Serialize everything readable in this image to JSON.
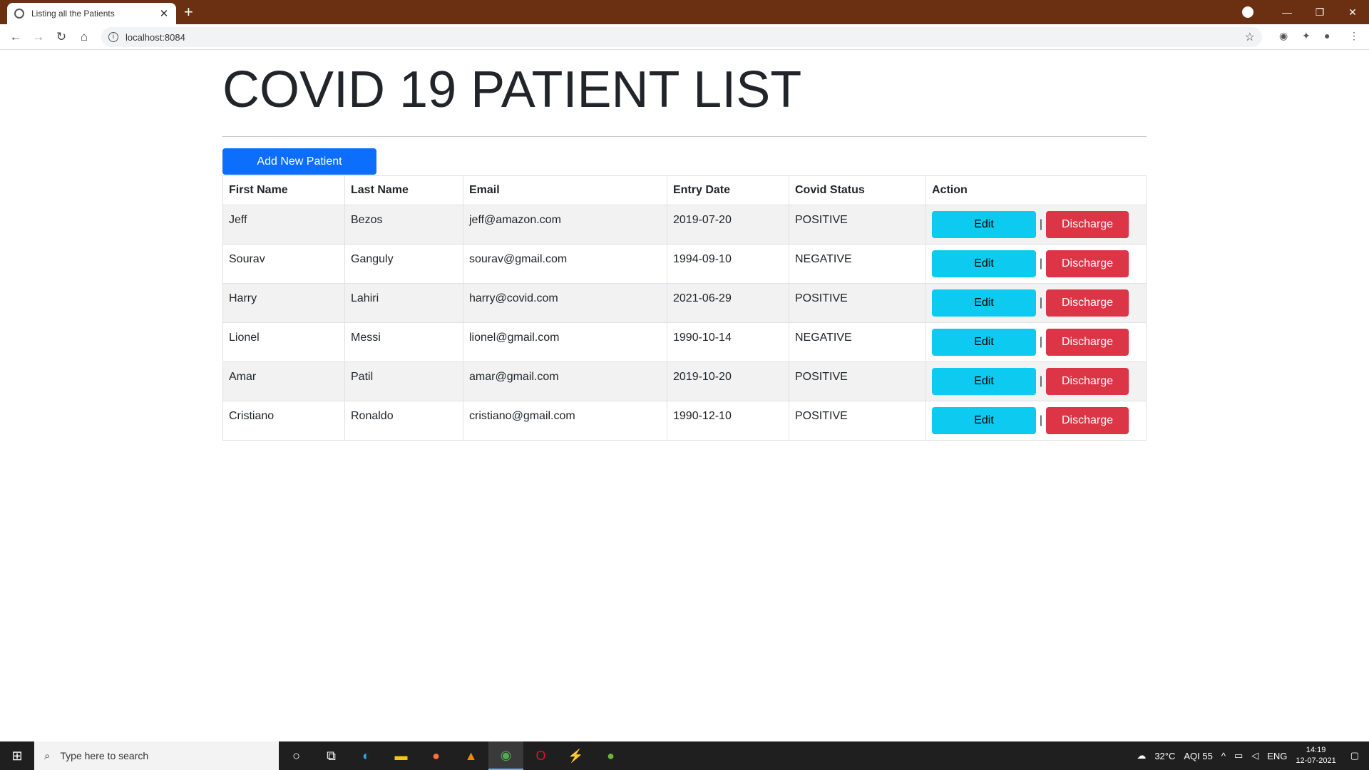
{
  "browser": {
    "tab_title": "Listing all the Patients",
    "url": "localhost:8084"
  },
  "page": {
    "heading": "COVID 19 PATIENT LIST",
    "add_button": "Add New Patient",
    "columns": [
      "First Name",
      "Last Name",
      "Email",
      "Entry Date",
      "Covid Status",
      "Action"
    ],
    "rows": [
      {
        "first": "Jeff",
        "last": "Bezos",
        "email": "jeff@amazon.com",
        "date": "2019-07-20",
        "status": "POSITIVE"
      },
      {
        "first": "Sourav",
        "last": "Ganguly",
        "email": "sourav@gmail.com",
        "date": "1994-09-10",
        "status": "NEGATIVE"
      },
      {
        "first": "Harry",
        "last": "Lahiri",
        "email": "harry@covid.com",
        "date": "2021-06-29",
        "status": "POSITIVE"
      },
      {
        "first": "Lionel",
        "last": "Messi",
        "email": "lionel@gmail.com",
        "date": "1990-10-14",
        "status": "NEGATIVE"
      },
      {
        "first": "Amar",
        "last": "Patil",
        "email": "amar@gmail.com",
        "date": "2019-10-20",
        "status": "POSITIVE"
      },
      {
        "first": "Cristiano",
        "last": "Ronaldo",
        "email": "cristiano@gmail.com",
        "date": "1990-12-10",
        "status": "POSITIVE"
      }
    ],
    "edit_label": "Edit",
    "separator": "|",
    "discharge_label": "Discharge"
  },
  "taskbar": {
    "search_placeholder": "Type here to search",
    "weather": "32°C",
    "aqi": "AQI 55",
    "lang": "ENG",
    "time": "14:19",
    "date": "12-07-2021"
  }
}
